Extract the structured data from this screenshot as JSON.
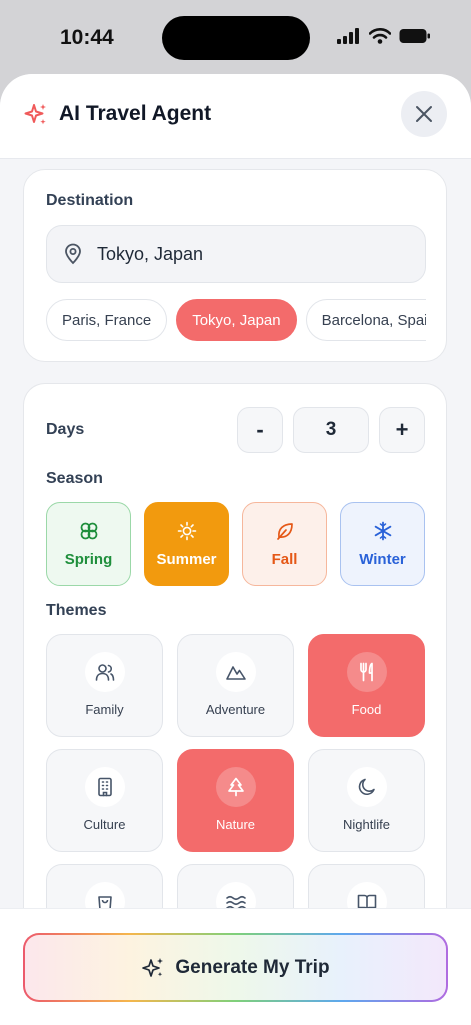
{
  "status": {
    "time": "10:44"
  },
  "header": {
    "title": "AI Travel Agent",
    "icon": "sparkles-icon",
    "close_icon": "close-icon"
  },
  "destination": {
    "label": "Destination",
    "value": "Tokyo, Japan",
    "chips": [
      {
        "label": "Paris, France",
        "selected": false
      },
      {
        "label": "Tokyo, Japan",
        "selected": true
      },
      {
        "label": "Barcelona, Spain",
        "selected": false
      }
    ]
  },
  "days": {
    "label": "Days",
    "minus": "-",
    "value": "3",
    "plus": "+"
  },
  "season": {
    "label": "Season",
    "options": [
      {
        "label": "Spring",
        "icon": "clover-icon",
        "selected": false
      },
      {
        "label": "Summer",
        "icon": "sun-icon",
        "selected": true
      },
      {
        "label": "Fall",
        "icon": "leaf-icon",
        "selected": false
      },
      {
        "label": "Winter",
        "icon": "snowflake-icon",
        "selected": false
      }
    ]
  },
  "themes": {
    "label": "Themes",
    "options": [
      {
        "label": "Family",
        "icon": "users-icon",
        "selected": false
      },
      {
        "label": "Adventure",
        "icon": "mountain-icon",
        "selected": false
      },
      {
        "label": "Food",
        "icon": "utensils-icon",
        "selected": true
      },
      {
        "label": "Culture",
        "icon": "building-icon",
        "selected": false
      },
      {
        "label": "Nature",
        "icon": "tree-icon",
        "selected": true
      },
      {
        "label": "Nightlife",
        "icon": "moon-icon",
        "selected": false
      },
      {
        "label": "",
        "icon": "shopping-bag-icon",
        "selected": false
      },
      {
        "label": "",
        "icon": "waves-icon",
        "selected": false
      },
      {
        "label": "",
        "icon": "book-icon",
        "selected": false
      }
    ]
  },
  "generate_button": {
    "label": "Generate My Trip",
    "icon": "sparkles-icon"
  },
  "colors": {
    "accent": "#f36b6b",
    "summer": "#f29a0e",
    "spring": "#1f8f3c",
    "fall": "#e55817",
    "winter": "#2a62d8"
  }
}
